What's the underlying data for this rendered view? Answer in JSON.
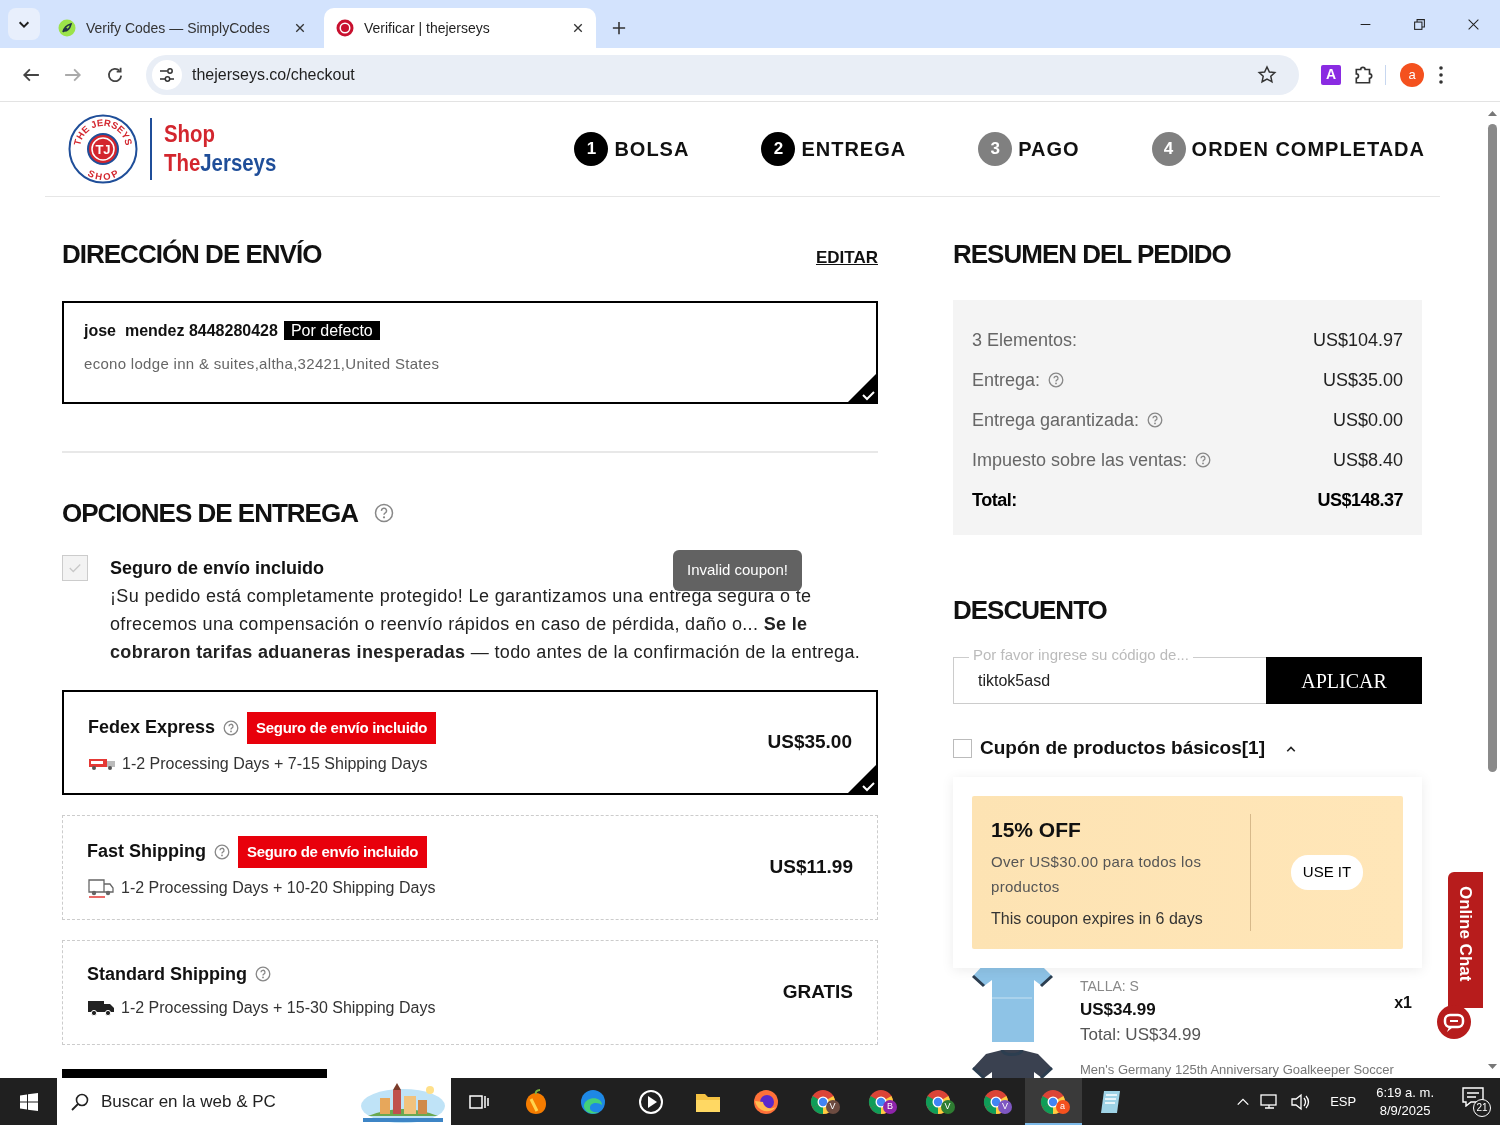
{
  "browser": {
    "tabs": [
      {
        "title": "Verify Codes — SimplyCodes",
        "selected": false,
        "kind": "leaf"
      },
      {
        "title": "Verificar | thejerseys",
        "selected": true,
        "kind": "tj"
      }
    ],
    "url": "thejerseys.co/checkout",
    "extension_letter": "A",
    "avatar": "a"
  },
  "header": {
    "logo": {
      "ring_top": "THE JERSEYS",
      "ring_bottom": "SHOP",
      "monogram": "TJ",
      "line1": "Shop",
      "line2_a": "The",
      "line2_b": "Jerseys"
    },
    "steps": [
      {
        "number": "1",
        "label": "BOLSA",
        "done": true
      },
      {
        "number": "2",
        "label": "ENTREGA",
        "done": true
      },
      {
        "number": "3",
        "label": "PAGO",
        "done": false
      },
      {
        "number": "4",
        "label": "ORDEN COMPLETADA",
        "done": false
      }
    ]
  },
  "shipping": {
    "title": "DIRECCIÓN DE ENVÍO",
    "edit": "EDITAR",
    "address": {
      "name": "jose  mendez 8448280428",
      "tag": "Por defecto",
      "line": "econo lodge inn & suites,altha,32421,United States",
      "selected": true
    }
  },
  "delivery": {
    "title": "OPCIONES DE ENTREGA",
    "insurance": {
      "label": "Seguro de envío incluido",
      "text": "¡Su pedido está completamente protegido! Le garantizamos una entrega segura o te ofrecemos una compensación o reenvío rápidos en caso de pérdida, daño o...  **Se le cobraron tarifas aduaneras inesperadas** — todo antes de la confirmación de la entrega.",
      "checked": true,
      "disabled": true
    },
    "options": [
      {
        "name": "Fedex Express",
        "tag": "Seguro de envío incluido",
        "details": "1-2 Processing Days + 7-15 Shipping Days",
        "price": "US$35.00",
        "selected": true,
        "kind": "fedex"
      },
      {
        "name": "Fast Shipping",
        "tag": "Seguro de envío incluido",
        "details": "1-2 Processing Days + 10-20 Shipping Days",
        "price": "US$11.99",
        "selected": false,
        "kind": "fast"
      },
      {
        "name": "Standard Shipping",
        "details": "1-2 Processing Days + 15-30 Shipping Days",
        "price": "GRATIS",
        "selected": false,
        "kind": "truck"
      }
    ]
  },
  "summary": {
    "title": "RESUMEN DEL PEDIDO",
    "rows": [
      {
        "label": "3 Elementos:",
        "value": "US$104.97",
        "help": false,
        "kind": "line"
      },
      {
        "label": "Entrega:",
        "value": "US$35.00",
        "help": true,
        "kind": "line"
      },
      {
        "label": "Entrega garantizada:",
        "value": "US$0.00",
        "help": true,
        "kind": "line"
      },
      {
        "label": "Impuesto sobre las ventas:",
        "value": "US$8.40",
        "help": true,
        "kind": "line"
      },
      {
        "label": "Total:",
        "value": "US$148.37",
        "help": false,
        "kind": "total"
      }
    ]
  },
  "discount": {
    "title": "DESCUENTO",
    "label": "Por favor ingrese su código de...",
    "value": "tiktok5asd",
    "button": "APLICAR",
    "coupons_toggle": {
      "label": "Cupón de productos básicos[1]",
      "checked": false,
      "expanded": true
    },
    "coupon": {
      "title": "15% OFF",
      "description": "Over US$30.00 para todos los productos",
      "expiry": "This coupon expires in 6 days",
      "button": "USE IT"
    }
  },
  "cart": [
    {
      "size": "TALLA: S",
      "price": "US$34.99",
      "total": "Total: US$34.99",
      "quantity": "x1"
    },
    {
      "title": "Men's Germany 125th Anniversary Goalkeeper Soccer"
    }
  ],
  "toast": "Invalid coupon!",
  "chat": "Online Chat",
  "taskbar": {
    "search_placeholder": "Buscar en la web & PC",
    "apps": [
      {
        "kind": "fl",
        "selected": false
      },
      {
        "kind": "edge",
        "selected": false
      },
      {
        "kind": "media",
        "selected": false
      },
      {
        "kind": "folder",
        "selected": false
      },
      {
        "kind": "firefox",
        "selected": false
      },
      {
        "kind": "chrome",
        "badge": "V",
        "color": "#6d4c41",
        "selected": false
      },
      {
        "kind": "chrome",
        "badge": "B",
        "color": "#8e24aa",
        "selected": false
      },
      {
        "kind": "chrome",
        "badge": "V",
        "color": "#2e7d32",
        "selected": false
      },
      {
        "kind": "chrome",
        "badge": "V",
        "color": "#7e57c2",
        "selected": false
      },
      {
        "kind": "chrome",
        "badge": "a",
        "color": "#f4511e",
        "selected": true
      },
      {
        "kind": "notes",
        "selected": false
      }
    ],
    "language": "ESP",
    "time": "6:19 a. m.",
    "date": "8/9/2025",
    "notifications": "21"
  }
}
